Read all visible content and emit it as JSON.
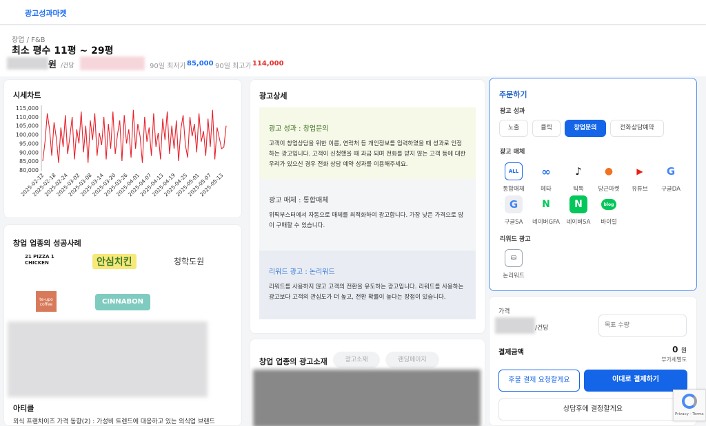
{
  "app": {
    "brand": "광고성과마켓"
  },
  "header": {
    "breadcrumb": "창업 / F&B",
    "title": "최소 평수 11평 ~ 29평",
    "price_unit": "원",
    "price_per": "/건당",
    "min_label": "90일 최저가",
    "min_value": "85,000",
    "max_label": "90일 최고가",
    "max_value": "114,000",
    "colors": {
      "min": "#1d6ff2",
      "max": "#e0322e"
    }
  },
  "chart_data": {
    "type": "line",
    "title": "시세차트",
    "ylim": [
      80000,
      115000
    ],
    "yticks": [
      "115,000",
      "110,000",
      "105,000",
      "100,000",
      "95,000",
      "90,000",
      "85,000",
      "80,000"
    ],
    "xticks": [
      "2025-02-12",
      "2025-02-18",
      "2025-02-24",
      "2025-03-02",
      "2025-03-08",
      "2025-03-14",
      "2025-03-20",
      "2025-03-26",
      "2025-04-01",
      "2025-04-07",
      "2025-04-13",
      "2025-04-19",
      "2025-04-25",
      "2025-05-01",
      "2025-05-07",
      "2025-05-13"
    ],
    "series": [
      {
        "color": "#e8202a",
        "values": [
          85000,
          96000,
          112000,
          103000,
          88000,
          107000,
          98000,
          84000,
          104000,
          93000,
          111000,
          89000,
          99000,
          110000,
          86000,
          103000,
          95000,
          113000,
          90000,
          105000,
          84000,
          108000,
          97000,
          112000,
          88000,
          101000,
          94000,
          110000,
          86000,
          106000,
          92000,
          113000,
          89000,
          100000,
          108000,
          85000,
          111000,
          95000,
          103000,
          87000,
          114000,
          92000,
          106000,
          99000,
          84000,
          110000,
          96000,
          104000,
          88000,
          112000,
          93000,
          101000,
          86000,
          109000,
          97000,
          113000,
          89000,
          105000,
          92000,
          108000,
          85000,
          103000,
          111000,
          94000,
          87000,
          110000,
          99000,
          106000,
          90000,
          112000,
          96000,
          102000,
          88000,
          109000,
          93000,
          114000,
          86000,
          104000,
          98000,
          92000,
          93000,
          105000
        ]
      }
    ]
  },
  "success": {
    "title": "창업 업종의 성공사례",
    "logos": [
      "21 PIZZA 1 CHICKEN",
      "안심치킨",
      "청학도원",
      "te-upo coffee",
      "CINNABON"
    ],
    "article_title": "아티클",
    "article_text": "외식 프랜차이즈 가격 동향(2) : 가성비 트렌드에 대응하고 있는 외식업 브랜드"
  },
  "detail": {
    "title": "광고상세",
    "box1_title": "광고 성과 : 창업문의",
    "box1_text": "고객이 창업상담을 위한 이름, 연락처 등 개인정보를 입력하였을 때 성과로 인정하는 광고입니다. 고객이 신청했을 때 과금 되며 전화를 받지 않는 고객 등에 대한 우려가 있으신 경우 전화 상담 예약 성과를 이용해주세요.",
    "box2_title": "광고 매체 : 통합매체",
    "box2_text": "위픽부스터에서 자동으로 매체를 최적화하여 광고합니다. 가장 낮은 가격으로 많이 구매할 수 있습니다.",
    "box3_title": "리워드 광고 : 논리워드",
    "box3_text": "리워드를 사용하지 않고 고객의 전환을 유도하는 광고입니다. 리워드를 사용하는 광고보다 고객의 관심도가 더 높고, 전환 확률이 높다는 장점이 있습니다.",
    "colors": {
      "box1": "#f6f9e8",
      "box2": "#f4f5f7",
      "box3": "#e9edf3",
      "box3_title": "#3a78d6"
    }
  },
  "creative": {
    "title": "창업 업종의 광고소재",
    "tabs": [
      "광고소재",
      "랜딩페이지"
    ]
  },
  "order": {
    "title": "주문하기",
    "perf_label": "광고 성과",
    "perf_options": [
      "노출",
      "클릭",
      "창업문의",
      "전화상담예약"
    ],
    "media_label": "광고 매체",
    "media": [
      {
        "icon": "all-icon",
        "glyph": "ALL",
        "label": "통합매체"
      },
      {
        "icon": "meta-icon",
        "glyph": "∞",
        "label": "메타"
      },
      {
        "icon": "tiktok-icon",
        "glyph": "♪",
        "label": "틱톡"
      },
      {
        "icon": "carrot-icon",
        "glyph": "●",
        "label": "당근마켓"
      },
      {
        "icon": "youtube-icon",
        "glyph": "▶",
        "label": "유튜브"
      },
      {
        "icon": "google-icon",
        "glyph": "G",
        "label": "구글DA"
      },
      {
        "icon": "google-sa-icon",
        "glyph": "G",
        "label": "구글SA"
      },
      {
        "icon": "naver-gfa-icon",
        "glyph": "N",
        "label": "네이버GFA"
      },
      {
        "icon": "naver-sa-icon",
        "glyph": "N",
        "label": "네이버SA"
      },
      {
        "icon": "blog-icon",
        "glyph": "blog",
        "label": "바이럴"
      }
    ],
    "reward_label": "리워드 광고",
    "reward_option": "논리워드"
  },
  "pay": {
    "price_label": "가격",
    "price_per": "/건당",
    "target_placeholder": "목표 수량",
    "total_label": "결제금액",
    "total_value": "0",
    "total_unit": "원",
    "vat": "부가세별도",
    "later_button": "후불 결제 요청할게요",
    "pay_button": "이대로 결제하기",
    "consult_button": "상담후에 결정할게요"
  },
  "recaptcha": {
    "text": "Privacy - Terms"
  }
}
